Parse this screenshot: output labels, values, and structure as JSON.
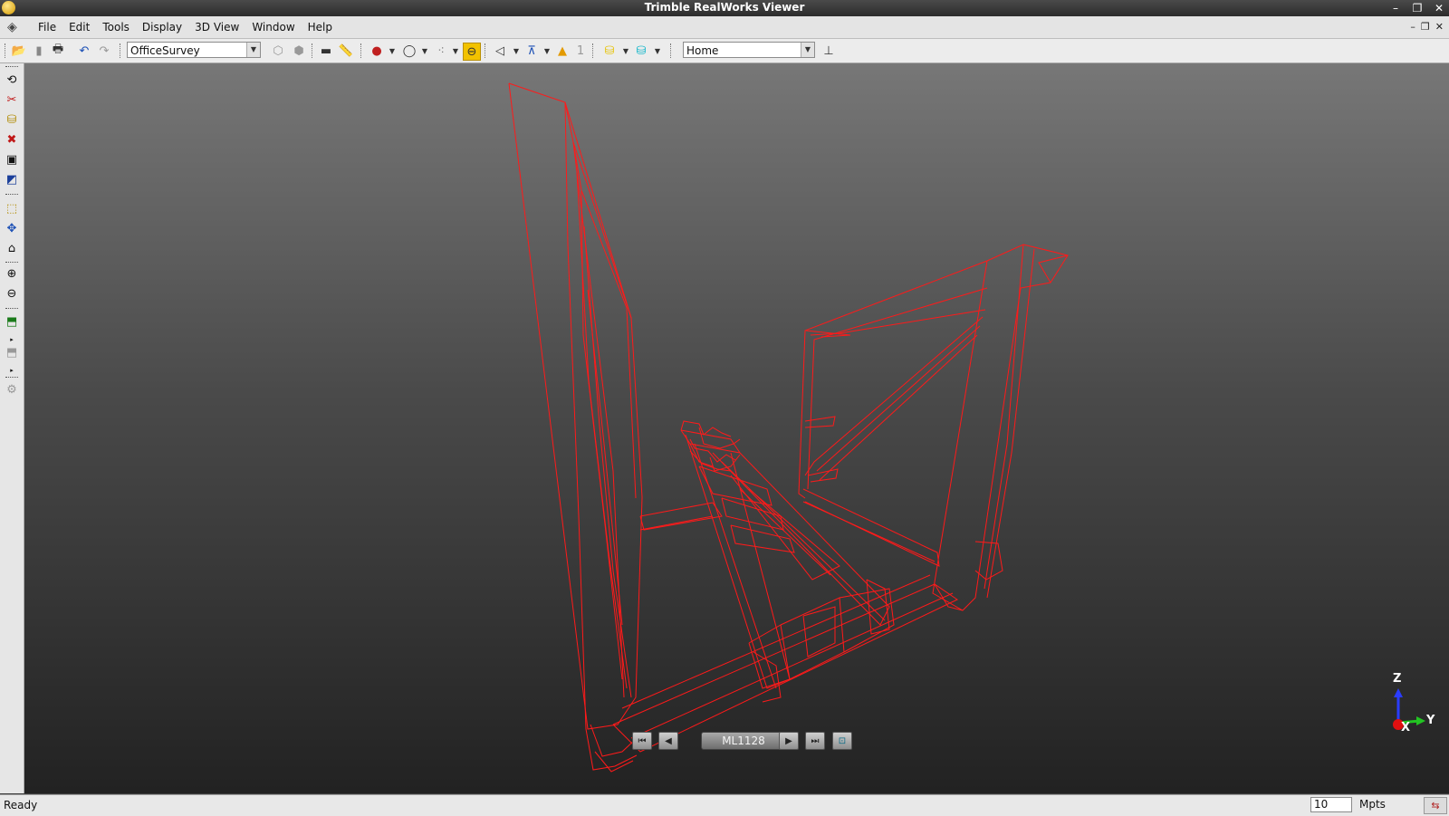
{
  "window": {
    "title": "Trimble RealWorks Viewer"
  },
  "menu": {
    "items": [
      "File",
      "Edit",
      "Tools",
      "Display",
      "3D View",
      "Window",
      "Help"
    ]
  },
  "toolbar": {
    "project_combo": "OfficeSurvey",
    "view_combo": "Home"
  },
  "scan_nav": {
    "current_scan": "ML1128"
  },
  "axes": {
    "z_label": "Z",
    "y_label": "Y",
    "x_label": "X"
  },
  "status": {
    "text": "Ready",
    "points_value": "10",
    "points_unit": "Mpts"
  },
  "colors": {
    "wireframe": "#ff1a1a",
    "viewport_top": "#777777",
    "viewport_bottom": "#222222"
  },
  "icons": {
    "toolbar": [
      "open-icon",
      "save-icon",
      "print-icon",
      "undo-icon",
      "redo-icon",
      "measure-icon",
      "ruler-icon",
      "color-icon",
      "sphere-icon",
      "points-icon",
      "eye-icon",
      "camera-icon",
      "station-icon",
      "warning-icon",
      "layer-icon",
      "display-icon",
      "axis-icon"
    ],
    "left": [
      "rotate-icon",
      "cut-icon",
      "segment-icon",
      "remove-icon",
      "box-icon",
      "render-icon",
      "object-icon",
      "pan-icon",
      "home-icon",
      "zoom-in-icon",
      "zoom-out-icon",
      "cube-icon",
      "cube-alt-icon",
      "settings-icon"
    ]
  }
}
